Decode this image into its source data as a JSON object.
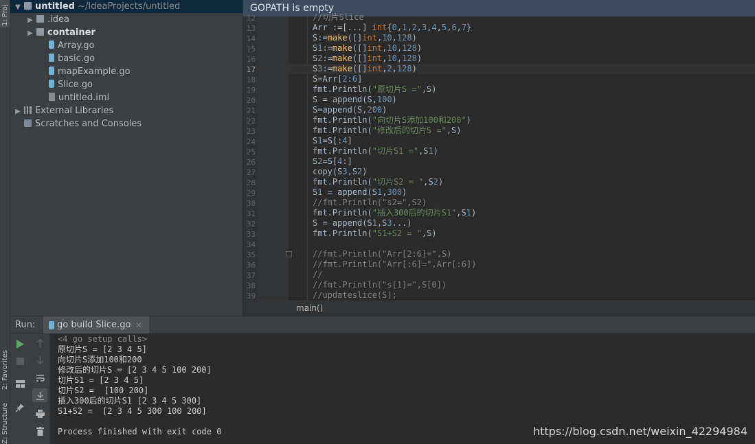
{
  "side_tabs": {
    "project": "1: Proj",
    "favorites": "2: Favorites",
    "structure": "Z: Structure"
  },
  "project_tree": [
    {
      "label": "untitled",
      "extra": "~/IdeaProjects/untitled",
      "icon": "folder-icon",
      "arrow": "▼",
      "indent": 0,
      "selected": true
    },
    {
      "label": ".idea",
      "icon": "folder-icon",
      "arrow": "▶",
      "indent": 1
    },
    {
      "label": "container",
      "icon": "folder-icon",
      "arrow": "▶",
      "indent": 1,
      "bold": true
    },
    {
      "label": "Array.go",
      "icon": "go-file-icon",
      "indent": 2
    },
    {
      "label": "basic.go",
      "icon": "go-file-icon",
      "indent": 2
    },
    {
      "label": "mapExample.go",
      "icon": "go-file-icon",
      "indent": 2
    },
    {
      "label": "Slice.go",
      "icon": "go-file-icon",
      "indent": 2
    },
    {
      "label": "untitled.iml",
      "icon": "iml-file-icon",
      "indent": 2
    },
    {
      "label": "External Libraries",
      "icon": "library-icon",
      "arrow": "▶",
      "indent": 0
    },
    {
      "label": "Scratches and Consoles",
      "icon": "scratch-icon",
      "indent": 0
    }
  ],
  "editor": {
    "banner": "GOPATH is empty",
    "current_line": "17",
    "breadcrumb": "main()",
    "lines": [
      {
        "n": "12",
        "code": "//切片Slice"
      },
      {
        "n": "13",
        "code": "Arr :=[...] int{0,1,2,3,4,5,6,7}"
      },
      {
        "n": "14",
        "code": "S:=make([]int,10,128)"
      },
      {
        "n": "15",
        "code": "S1:=make([]int,10,128)"
      },
      {
        "n": "16",
        "code": "S2:=make([]int,10,128)"
      },
      {
        "n": "17",
        "code": "S3:=make([]int,2,128)"
      },
      {
        "n": "18",
        "code": "S=Arr[2:6]"
      },
      {
        "n": "19",
        "code": "fmt.Println(\"原切片S =\",S)"
      },
      {
        "n": "20",
        "code": "S = append(S,100)"
      },
      {
        "n": "21",
        "code": "S=append(S,200)"
      },
      {
        "n": "22",
        "code": "fmt.Println(\"向切片S添加100和200\")"
      },
      {
        "n": "23",
        "code": "fmt.Println(\"修改后的切片S =\",S)"
      },
      {
        "n": "24",
        "code": "S1=S[:4]"
      },
      {
        "n": "25",
        "code": "fmt.Println(\"切片S1 =\",S1)"
      },
      {
        "n": "26",
        "code": "S2=S[4:]"
      },
      {
        "n": "27",
        "code": "copy(S3,S2)"
      },
      {
        "n": "28",
        "code": "fmt.Println(\"切片S2 = \",S2)"
      },
      {
        "n": "29",
        "code": "S1 = append(S1,300)"
      },
      {
        "n": "30",
        "code": "//fmt.Println(\"s2=\",S2)"
      },
      {
        "n": "31",
        "code": "fmt.Println(\"插入300后的切片S1\",S1)"
      },
      {
        "n": "32",
        "code": "S = append(S1,S3...)"
      },
      {
        "n": "33",
        "code": "fmt.Println(\"S1+S2 = \",S)"
      },
      {
        "n": "34",
        "code": ""
      },
      {
        "n": "35",
        "code": "//fmt.Println(\"Arr[2:6]=\",S)"
      },
      {
        "n": "36",
        "code": "//fmt.Println(\"Arr[:6]=\",Arr[:6])"
      },
      {
        "n": "37",
        "code": "//"
      },
      {
        "n": "38",
        "code": "//fmt.Println(\"s[1]=\",S[0])"
      },
      {
        "n": "39",
        "code": "//updateslice(S);"
      }
    ]
  },
  "run": {
    "label": "Run:",
    "tab_label": "go build Slice.go",
    "tab_close": "×",
    "output": [
      "<4 go setup calls>",
      "原切片S = [2 3 4 5]",
      "向切片S添加100和200",
      "修改后的切片S = [2 3 4 5 100 200]",
      "切片S1 = [2 3 4 5]",
      "切片S2 =  [100 200]",
      "插入300后的切片S1 [2 3 4 5 300]",
      "S1+S2 =  [2 3 4 5 300 100 200]",
      "",
      "Process finished with exit code 0"
    ]
  },
  "watermark": "https://blog.csdn.net/weixin_42294984",
  "colors": {
    "keyword": "#cc7832",
    "func": "#ffc66d",
    "number": "#6897bb",
    "string": "#6a8759",
    "comment": "#808080",
    "banner": "#3d4b5c"
  }
}
